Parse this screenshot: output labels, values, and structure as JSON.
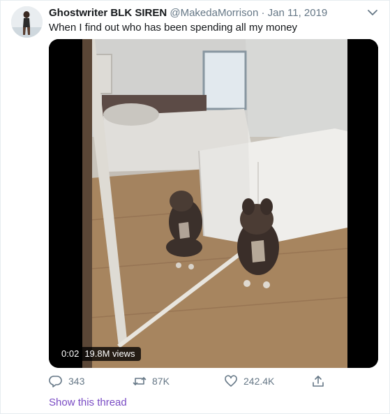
{
  "tweet": {
    "author": {
      "display_name": "Ghostwriter BLK SIREN",
      "handle": "@MakedaMorrison",
      "separator": "·",
      "date": "Jan 11, 2019",
      "avatar_icon": "profile-photo"
    },
    "text": "When I find out who has been spending all my money",
    "media": {
      "type": "video",
      "timestamp": "0:02",
      "views": "19.8M views"
    },
    "actions": {
      "reply_count": "343",
      "retweet_count": "87K",
      "like_count": "242.4K",
      "reply_icon": "reply-icon",
      "retweet_icon": "retweet-icon",
      "like_icon": "heart-icon",
      "share_icon": "share-icon"
    },
    "show_thread_label": "Show this thread",
    "colors": {
      "link": "#794bc4",
      "secondary_text": "#657786",
      "primary_text": "#14171a",
      "border": "#e6ecf0"
    }
  }
}
